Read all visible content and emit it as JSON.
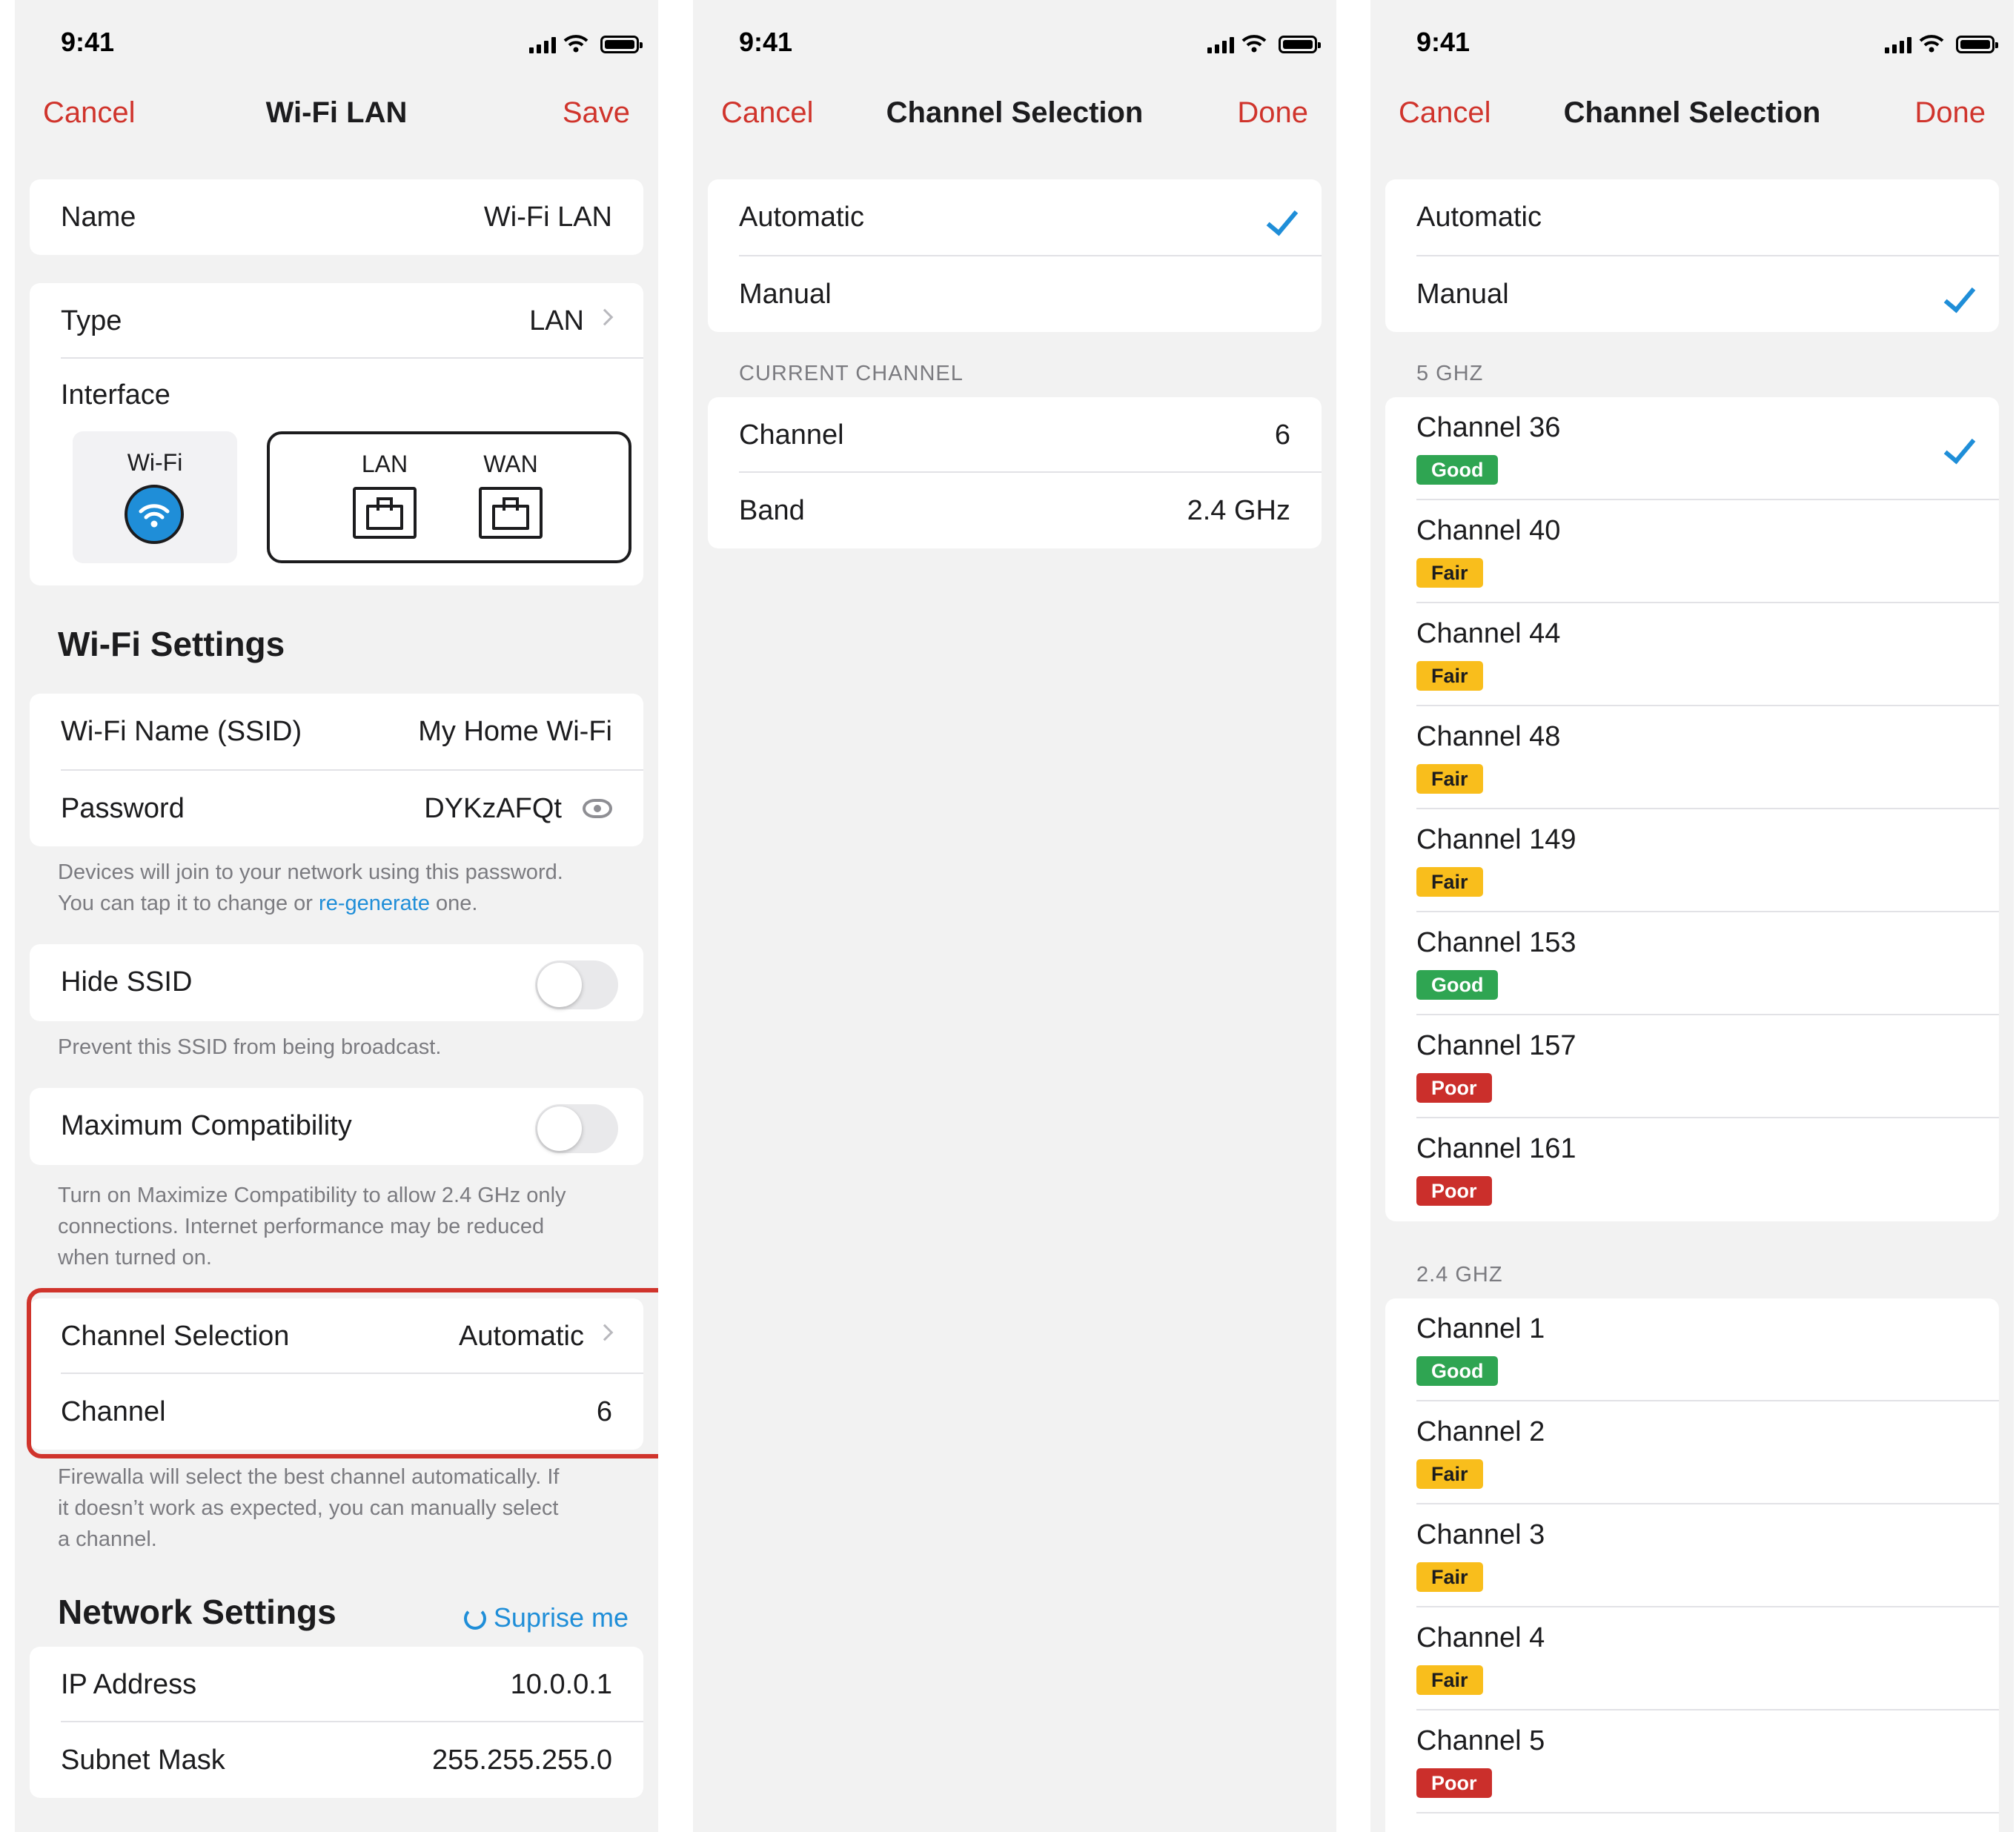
{
  "status_time": "9:41",
  "screen1": {
    "nav": {
      "cancel": "Cancel",
      "title": "Wi-Fi LAN",
      "save": "Save"
    },
    "name": {
      "label": "Name",
      "value": "Wi-Fi LAN"
    },
    "type": {
      "label": "Type",
      "value": "LAN"
    },
    "interface": {
      "label": "Interface",
      "wifi": "Wi-Fi",
      "lan": "LAN",
      "wan": "WAN"
    },
    "wifi_settings_heading": "Wi-Fi Settings",
    "ssid": {
      "label": "Wi-Fi Name (SSID)",
      "value": "My Home Wi-Fi"
    },
    "password": {
      "label": "Password",
      "value": "DYKzAFQt"
    },
    "password_note": {
      "part1": "Devices will join to your network using this password.",
      "part2": "You can tap it to change or ",
      "link": "re-generate",
      "part3": " one."
    },
    "hide_ssid": {
      "label": "Hide SSID",
      "note": "Prevent this SSID from being broadcast."
    },
    "max_compat": {
      "label": "Maximum Compatibility",
      "note_l1": "Turn on Maximize Compatibility to allow 2.4 GHz only",
      "note_l2": "connections. Internet performance may be reduced",
      "note_l3": "when turned on."
    },
    "channel_selection": {
      "label": "Channel Selection",
      "value": "Automatic"
    },
    "channel": {
      "label": "Channel",
      "value": "6"
    },
    "channel_note": {
      "l1": "Firewalla will select the best channel automatically. If",
      "l2": "it doesn’t work as expected, you can manually select",
      "l3": "a channel."
    },
    "network_settings_heading": "Network Settings",
    "surprise": "Suprise me",
    "ip": {
      "label": "IP Address",
      "value": "10.0.0.1"
    },
    "subnet": {
      "label": "Subnet Mask",
      "value": "255.255.255.0"
    }
  },
  "screen2": {
    "nav": {
      "cancel": "Cancel",
      "title": "Channel Selection",
      "done": "Done"
    },
    "automatic": "Automatic",
    "manual": "Manual",
    "selected_mode": "Automatic",
    "current_channel_header": "CURRENT CHANNEL",
    "channel": {
      "label": "Channel",
      "value": "6"
    },
    "band": {
      "label": "Band",
      "value": "2.4 GHz"
    }
  },
  "screen3": {
    "nav": {
      "cancel": "Cancel",
      "title": "Channel Selection",
      "done": "Done"
    },
    "automatic": "Automatic",
    "manual": "Manual",
    "selected_mode": "Manual",
    "ghz5_header": "5 GHZ",
    "ghz5_channels": [
      {
        "label": "Channel 36",
        "quality": "Good",
        "selected": true
      },
      {
        "label": "Channel 40",
        "quality": "Fair"
      },
      {
        "label": "Channel 44",
        "quality": "Fair"
      },
      {
        "label": "Channel 48",
        "quality": "Fair"
      },
      {
        "label": "Channel 149",
        "quality": "Fair"
      },
      {
        "label": "Channel 153",
        "quality": "Good"
      },
      {
        "label": "Channel 157",
        "quality": "Poor"
      },
      {
        "label": "Channel 161",
        "quality": "Poor"
      }
    ],
    "ghz24_header": "2.4 GHZ",
    "ghz24_channels": [
      {
        "label": "Channel 1",
        "quality": "Good"
      },
      {
        "label": "Channel 2",
        "quality": "Fair"
      },
      {
        "label": "Channel 3",
        "quality": "Fair"
      },
      {
        "label": "Channel 4",
        "quality": "Fair"
      },
      {
        "label": "Channel 5",
        "quality": "Poor"
      }
    ]
  },
  "colors": {
    "accent_red": "#d0342c",
    "link_blue": "#1f8ed8",
    "good": "#2fa552",
    "fair": "#f9be1c",
    "poor": "#cb2f2b"
  }
}
